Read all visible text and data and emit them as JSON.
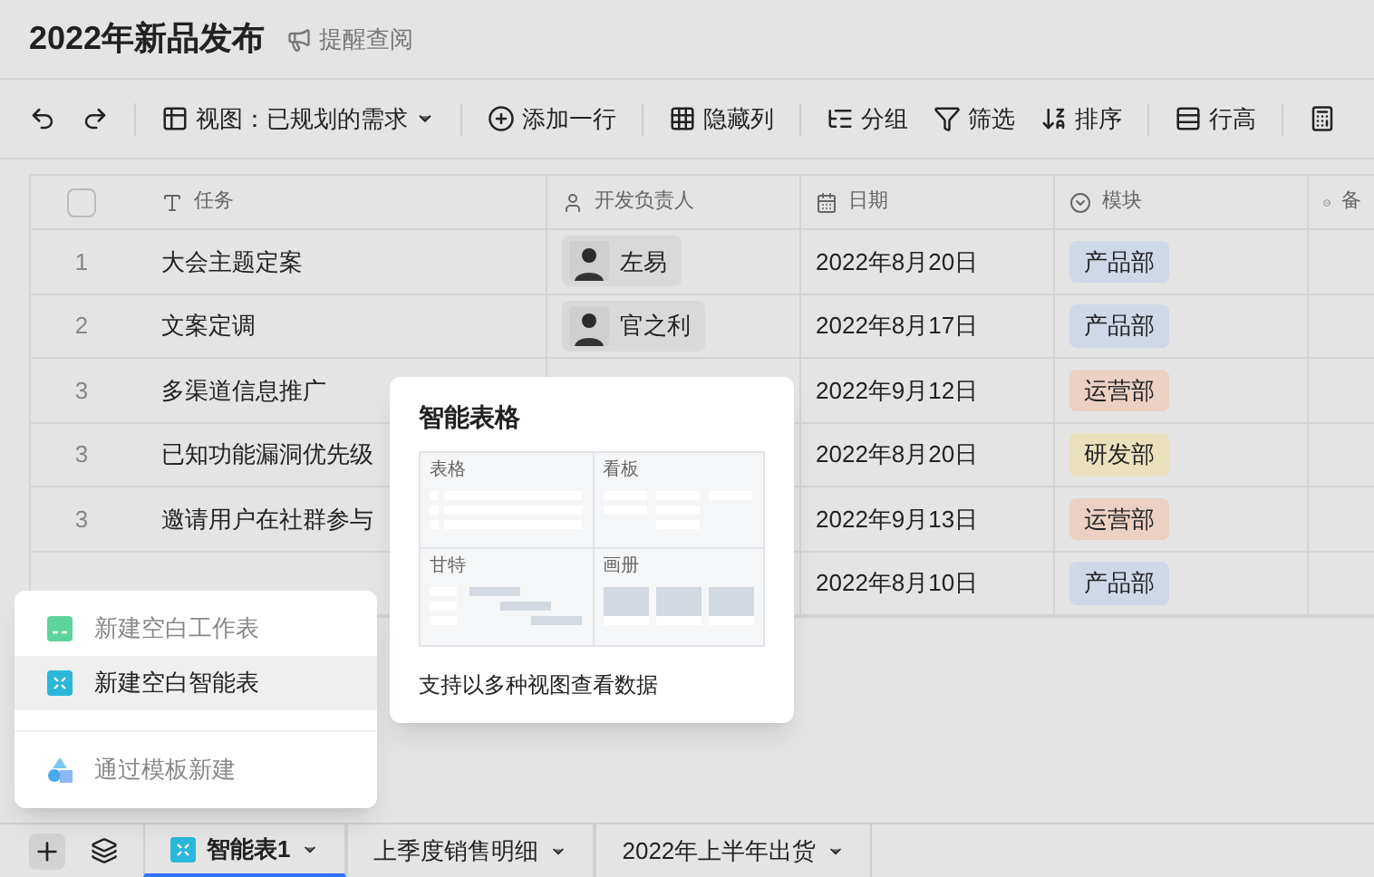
{
  "header": {
    "title": "2022年新品发布",
    "reminder": "提醒查阅"
  },
  "toolbar": [
    {
      "kind": "undo"
    },
    {
      "kind": "redo"
    },
    {
      "kind": "separator"
    },
    {
      "kind": "view",
      "label": "视图：已规划的需求"
    },
    {
      "kind": "separator"
    },
    {
      "kind": "add_row",
      "label": "添加一行"
    },
    {
      "kind": "separator"
    },
    {
      "kind": "hide_columns",
      "label": "隐藏列"
    },
    {
      "kind": "separator"
    },
    {
      "kind": "group",
      "label": "分组"
    },
    {
      "kind": "filter",
      "label": "筛选"
    },
    {
      "kind": "sort",
      "label": "排序"
    },
    {
      "kind": "separator"
    },
    {
      "kind": "row_height",
      "label": "行高"
    },
    {
      "kind": "separator"
    },
    {
      "kind": "calculator"
    }
  ],
  "table": {
    "select_all": {
      "checked": false
    },
    "columns": [
      {
        "kind": "text",
        "label": "任务"
      },
      {
        "kind": "person",
        "label": "开发负责人"
      },
      {
        "kind": "date",
        "label": "日期"
      },
      {
        "kind": "select",
        "label": "模块"
      },
      {
        "kind": "select",
        "label": "备"
      }
    ],
    "rows": [
      {
        "number": "1",
        "task": "大会主题定案",
        "owner": "左易",
        "date": "2022年8月20日",
        "module": {
          "label": "产品部",
          "color": "#cfd8e6"
        }
      },
      {
        "number": "2",
        "task": "文案定调",
        "owner": "官之利",
        "date": "2022年8月17日",
        "module": {
          "label": "产品部",
          "color": "#cfd8e6"
        }
      },
      {
        "number": "3",
        "task": "多渠道信息推广",
        "date": "2022年9月12日",
        "module": {
          "label": "运营部",
          "color": "#ecd0c2"
        }
      },
      {
        "number": "3",
        "task": "已知功能漏洞优先级",
        "date": "2022年8月20日",
        "module": {
          "label": "研发部",
          "color": "#e9e0bd"
        }
      },
      {
        "number": "3",
        "task": "邀请用户在社群参与",
        "date": "2022年9月13日",
        "module": {
          "label": "运营部",
          "color": "#ecd0c2"
        }
      },
      {
        "date": "2022年8月10日",
        "module": {
          "label": "产品部",
          "color": "#cfd8e6"
        }
      }
    ]
  },
  "popover": {
    "title": "智能表格",
    "views": [
      {
        "kind": "table",
        "label": "表格"
      },
      {
        "kind": "kanban",
        "label": "看板"
      },
      {
        "kind": "gantt",
        "label": "甘特"
      },
      {
        "kind": "gallery",
        "label": "画册"
      }
    ],
    "caption": "支持以多种视图查看数据"
  },
  "menu": [
    {
      "kind": "sheet",
      "label": "新建空白工作表",
      "selected": false
    },
    {
      "kind": "smart",
      "label": "新建空白智能表",
      "selected": true
    },
    {
      "kind": "template",
      "label": "通过模板新建",
      "selected": false
    }
  ],
  "tabs": [
    {
      "kind": "smart",
      "label": "智能表1",
      "selected": true
    },
    {
      "kind": "plain",
      "label": "上季度销售明细",
      "selected": false
    },
    {
      "kind": "plain",
      "label": "2022年上半年出货",
      "selected": false
    }
  ]
}
